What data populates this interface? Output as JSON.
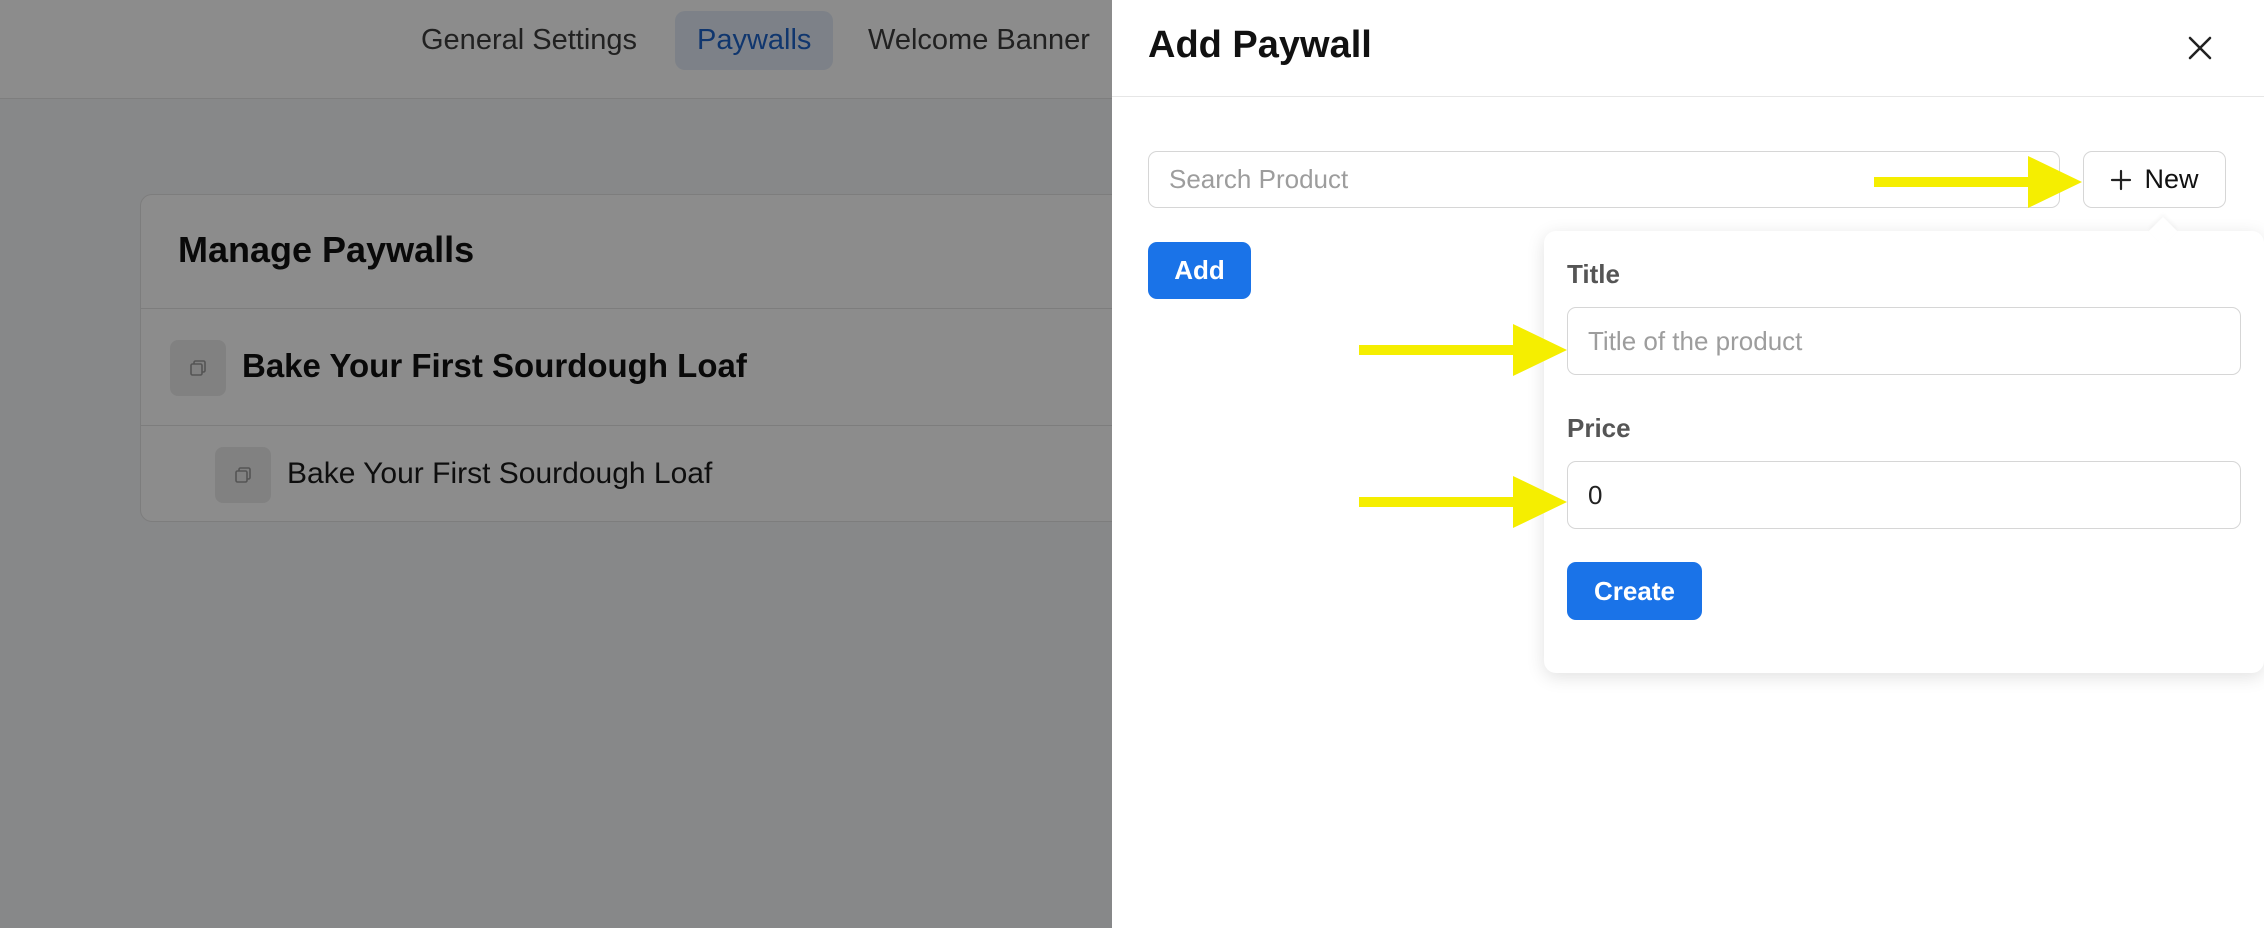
{
  "nav": {
    "tabs": [
      {
        "label": "General Settings"
      },
      {
        "label": "Paywalls"
      },
      {
        "label": "Welcome Banner"
      }
    ]
  },
  "manage": {
    "title": "Manage Paywalls",
    "items": [
      {
        "label": "Bake Your First Sourdough Loaf"
      },
      {
        "label": "Bake Your First Sourdough Loaf"
      }
    ]
  },
  "drawer": {
    "title": "Add Paywall",
    "search_placeholder": "Search Product",
    "new_label": "New",
    "add_label": "Add"
  },
  "popover": {
    "title_label": "Title",
    "title_placeholder": "Title of the product",
    "price_label": "Price",
    "price_value": "0",
    "create_label": "Create"
  },
  "colors": {
    "primary": "#1a73e8",
    "annotation_arrow": "#f5ee00",
    "active_tab_bg": "#e3ecf8"
  }
}
